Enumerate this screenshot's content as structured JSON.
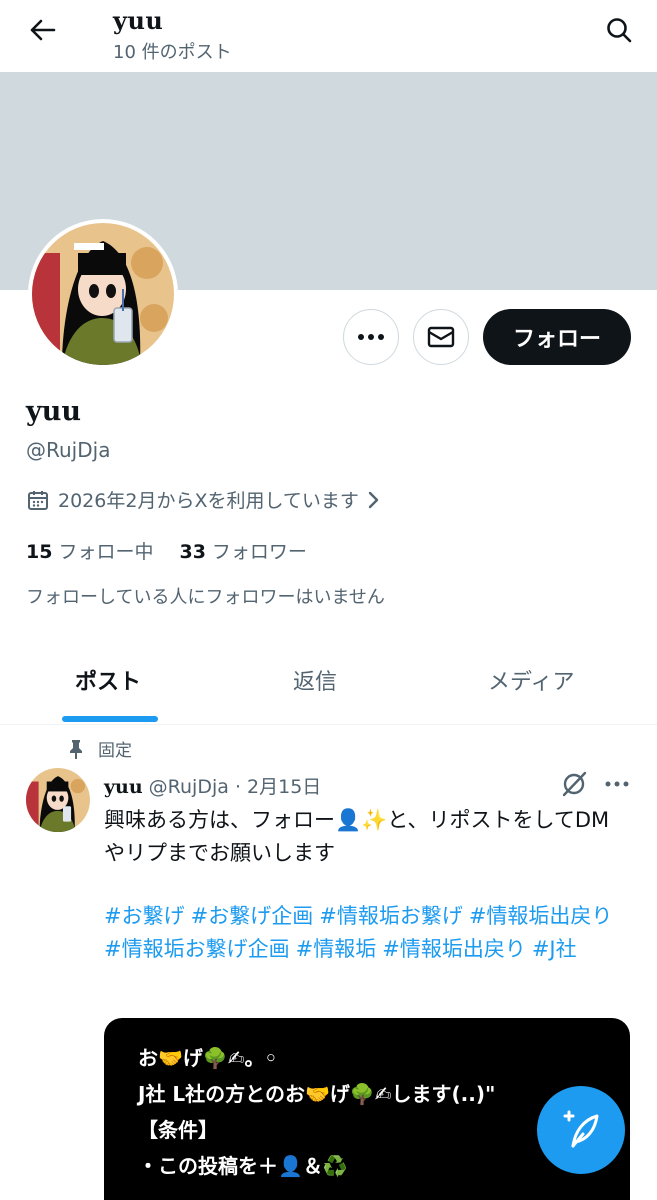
{
  "header": {
    "title": "yuu",
    "post_count": "10 件のポスト",
    "back_icon": "arrow-left-icon",
    "search_icon": "search-icon"
  },
  "profile": {
    "name": "yuu",
    "handle": "@RujDja",
    "joined": "2026年2月からXを利用しています",
    "following_count": "15",
    "following_label": "フォロー中",
    "followers_count": "33",
    "followers_label": "フォロワー",
    "no_mutuals": "フォローしている人にフォロワーはいません",
    "follow_label": "フォロー"
  },
  "tabs": [
    {
      "label": "ポスト",
      "active": true
    },
    {
      "label": "返信",
      "active": false
    },
    {
      "label": "メディア",
      "active": false
    }
  ],
  "pinned_post": {
    "pinned_label": "固定",
    "name": "yuu",
    "handle": "@RujDja",
    "separator": "·",
    "date": "2月15日",
    "text": "興味ある方は、フォロー👤✨と、リポストをしてDMやリプまでお願いします",
    "hashtags": [
      "#お繋げ",
      "#お繋げ企画",
      "#情報垢お繋げ",
      "#情報垢出戻り",
      "#情報垢お繋げ企画",
      "#情報垢",
      "#情報垢出戻り",
      "#J社"
    ],
    "image_lines": [
      "お🤝げ🌳✍。◦",
      "J社 L社の方とのお🤝げ🌳✍します(..)\"",
      "【条件】",
      "・この投稿を＋👤＆♻️"
    ]
  },
  "colors": {
    "accent": "#1d9bf0",
    "banner": "#cfd9de",
    "text_primary": "#0f1419",
    "text_secondary": "#536471"
  }
}
